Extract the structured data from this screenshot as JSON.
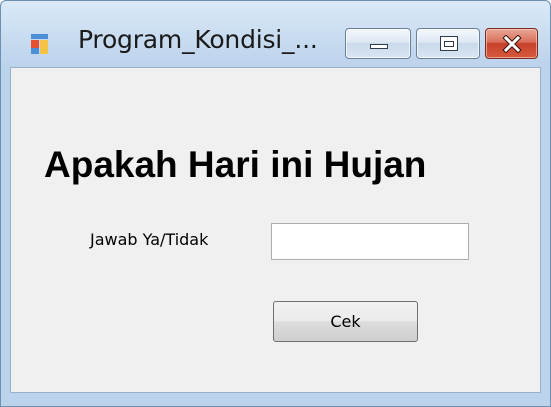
{
  "window": {
    "title": "Program_Kondisi_...",
    "icon": "windows-form-icon",
    "caption_buttons": {
      "minimize": "minimize-icon",
      "maximize": "maximize-icon",
      "close": "close-icon"
    }
  },
  "form": {
    "heading": "Apakah Hari ini Hujan",
    "answer_label": "Jawab Ya/Tidak",
    "answer_value": "",
    "submit_label": "Cek"
  },
  "colors": {
    "title_bar": "#c7dbf0",
    "client_background": "#f0f0f0",
    "close_button": "#c7412a"
  }
}
